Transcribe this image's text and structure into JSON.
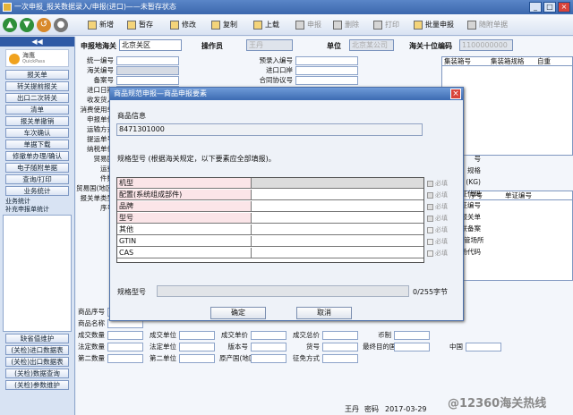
{
  "window": {
    "title": "一次申报_报关数据录入/申报(进口)——未暂存状态"
  },
  "toolbar": {
    "new": "新增",
    "save": "暂存",
    "modify": "修改",
    "copy": "复制",
    "upload": "上载",
    "declare": "申报",
    "delete": "删除",
    "print": "打印",
    "batch": "批量申报",
    "consult": "随附单据"
  },
  "sidebar": {
    "toggle": "◀◀",
    "logo_name": "海鹰",
    "logo_sub": "QuickPass",
    "items": [
      "报关单",
      "转关提前报关",
      "出口二次转关",
      "清单",
      "报关单撤销",
      "车次确认",
      "单据下载",
      "修撤单办理/确认",
      "电子随附单据",
      "查询/打印",
      "业务统计"
    ],
    "sub": [
      "业务统计",
      "补充申报单统计"
    ],
    "bottom": [
      "缺省值维护",
      "(关检)进口数据表",
      "(关检)出口数据表",
      "(关检)数据查询",
      "(关检)参数维护"
    ]
  },
  "header": {
    "port_label": "申报地海关",
    "port_value": "北京关区",
    "operator_label": "操作员",
    "operator_value": "王丹",
    "unit_label": "单位",
    "unit_value": "北京某公司",
    "code_label": "海关十位编码",
    "code_value": "1100000000"
  },
  "form": {
    "left": [
      "统一编号",
      "海关编号",
      "备案号",
      "进口日期",
      "收发货人",
      "消费使用单",
      "申报单位",
      "运输方式",
      "提运单号",
      "纳税单位",
      "贸易国",
      "运费",
      "件数",
      "贸易国(地区)",
      "报关单类型",
      "序号"
    ],
    "mid": [
      "预录入编号",
      "进口口岸",
      "合同协议号"
    ],
    "bottom_r1": [
      "商品序号"
    ],
    "bottom_r2": [
      "商品名称"
    ],
    "bottom_r3": [
      "成交数量",
      "成交单位",
      "成交单价",
      "成交总价",
      "币制"
    ],
    "bottom_r4": [
      "法定数量",
      "法定单位",
      "版本号",
      "货号",
      "最终目的国(地区)",
      "中国"
    ],
    "bottom_r5": [
      "第二数量",
      "第二单位",
      "原产国(地区)",
      "征免方式"
    ]
  },
  "right": {
    "cols": [
      "集装箱号",
      "集装箱规格",
      "自重"
    ],
    "cert_cols": [
      "序号",
      "单证编号"
    ],
    "side_labels": [
      "号",
      "规格",
      "(KG)",
      "证代码",
      "证编号",
      "报关单",
      "关联备案",
      "保税/监管场所",
      "货场代码"
    ]
  },
  "status": {
    "operator": "王丹",
    "role": "密码",
    "date": "2017-03-29"
  },
  "watermark": "@12360海关热线",
  "dialog": {
    "title": "商品规范申报—商品申报要素",
    "close": "×",
    "info_label": "商品信息",
    "hs_code": "8471301000",
    "spec_heading": "规格型号 (根据海关规定，以下要素应全部填报)。",
    "elements": [
      {
        "name": "机型",
        "required": true
      },
      {
        "name": "配置(系统组成部件)",
        "required": true
      },
      {
        "name": "品牌",
        "required": true
      },
      {
        "name": "型号",
        "required": true
      },
      {
        "name": "其他",
        "required": false
      },
      {
        "name": "GTIN",
        "required": false
      },
      {
        "name": "CAS",
        "required": false
      }
    ],
    "required_text": "必填",
    "spec_label": "规格型号",
    "count_text": "0/255字节",
    "ok": "确定",
    "cancel": "取消"
  }
}
